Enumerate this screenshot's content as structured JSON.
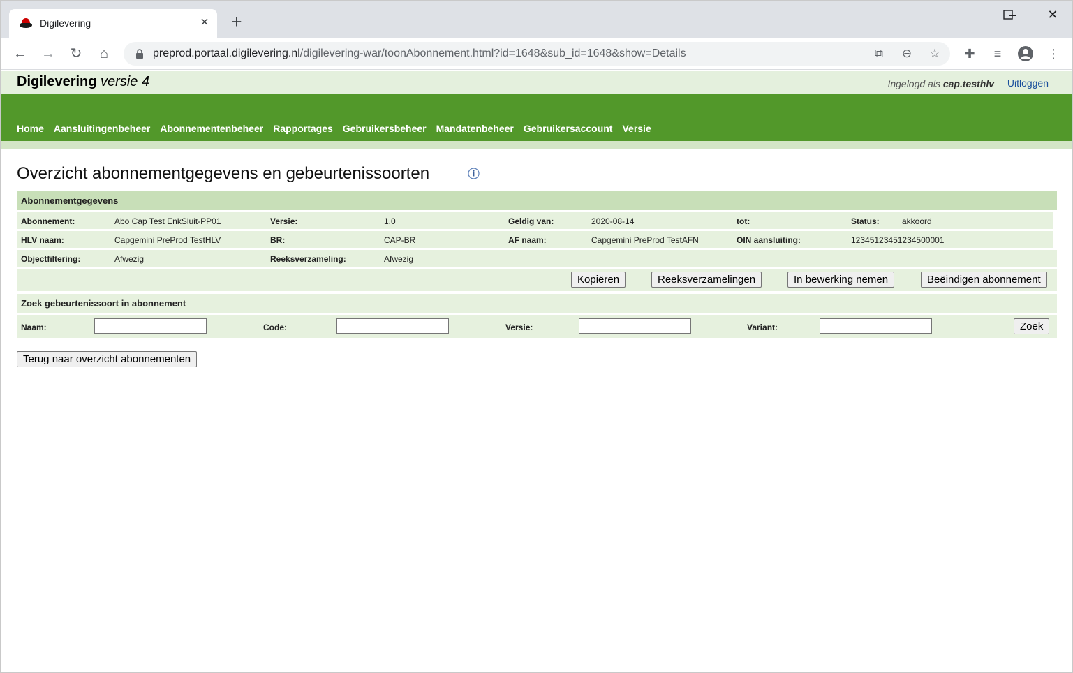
{
  "browser": {
    "tab_title": "Digilevering",
    "url_host": "preprod.portaal.digilevering.nl",
    "url_path": "/digilevering-war/toonAbonnement.html?id=1648&sub_id=1648&show=Details"
  },
  "app": {
    "title": "Digilevering",
    "version": "versie 4",
    "login_prefix": "Ingelogd als",
    "login_user": "cap.testhlv",
    "logout": "Uitloggen"
  },
  "nav": {
    "items": [
      "Home",
      "Aansluitingenbeheer",
      "Abonnementenbeheer",
      "Rapportages",
      "Gebruikersbeheer",
      "Mandatenbeheer",
      "Gebruikersaccount",
      "Versie"
    ]
  },
  "page": {
    "title": "Overzicht abonnementgegevens en gebeurtenissoorten"
  },
  "details": {
    "section_title": "Abonnementgegevens",
    "row1": {
      "abonnement_label": "Abonnement:",
      "abonnement_value": "Abo Cap Test EnkSluit-PP01",
      "versie_label": "Versie:",
      "versie_value": "1.0",
      "geldig_label": "Geldig van:",
      "geldig_value": "2020-08-14",
      "tot_label": "tot:",
      "tot_value": "",
      "status_label": "Status:",
      "status_value": "akkoord"
    },
    "row2": {
      "hlv_label": "HLV naam:",
      "hlv_value": "Capgemini PreProd TestHLV",
      "br_label": "BR:",
      "br_value": "CAP-BR",
      "af_label": "AF naam:",
      "af_value": "Capgemini PreProd TestAFN",
      "oin_label": "OIN aansluiting:",
      "oin_value": "12345123451234500001"
    },
    "row3": {
      "objectfiltering_label": "Objectfiltering:",
      "objectfiltering_value": "Afwezig",
      "reeks_label": "Reeksverzameling:",
      "reeks_value": "Afwezig"
    }
  },
  "actions": {
    "copy": "Kopiëren",
    "series": "Reeksverzamelingen",
    "edit": "In bewerking nemen",
    "end": "Beëindigen abonnement"
  },
  "search": {
    "title": "Zoek gebeurtenissoort in abonnement",
    "naam_label": "Naam:",
    "naam_value": "",
    "code_label": "Code:",
    "code_value": "",
    "versie_label": "Versie:",
    "versie_value": "",
    "variant_label": "Variant:",
    "variant_value": "",
    "button": "Zoek"
  },
  "back_button": "Terug naar overzicht abonnementen"
}
